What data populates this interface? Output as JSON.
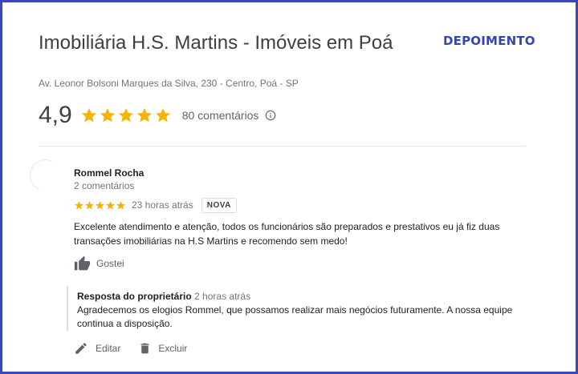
{
  "corner_tag": "DEPOIMENTO",
  "business": {
    "name": "Imobiliária H.S. Martins - Imóveis em Poá",
    "address": "Av. Leonor Bolsoni Marques da Silva, 230 - Centro, Poá - SP",
    "rating": "4,9",
    "stars": 5,
    "review_count": "80 comentários",
    "info_icon": "info-icon"
  },
  "colors": {
    "star": "#f4b400",
    "frame_border": "#3c46b4",
    "tag_text": "#3345b8"
  },
  "review": {
    "author": "Rommel Rocha",
    "author_meta": "2 comentários",
    "stars": 5,
    "time": "23 horas atrás",
    "badge": "NOVA",
    "text": "Excelente atendimento e atenção, todos os funcionários são preparados e prestativos eu já fiz duas transações imobiliárias na H.S Martins e recomendo sem medo!",
    "like_label": "Gostei",
    "like_icon": "thumbs-up-icon"
  },
  "owner_response": {
    "title": "Resposta do proprietário",
    "time": "2 horas atrás",
    "text": "Agradecemos os elogios Rommel, que possamos realizar mais negócios futuramente. A nossa equipe continua a disposição."
  },
  "actions": {
    "edit_label": "Editar",
    "edit_icon": "pencil-icon",
    "delete_label": "Excluir",
    "delete_icon": "trash-icon"
  }
}
